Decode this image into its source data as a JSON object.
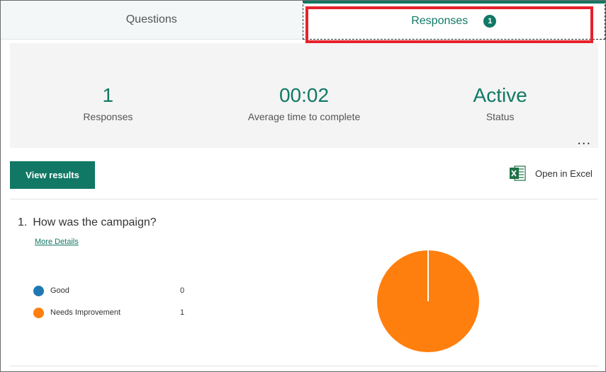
{
  "tabs": {
    "questions_label": "Questions",
    "responses_label": "Responses",
    "responses_count": "1"
  },
  "summary": {
    "responses_value": "1",
    "responses_label": "Responses",
    "avg_time_value": "00:02",
    "avg_time_label": "Average time to complete",
    "status_value": "Active",
    "status_label": "Status",
    "more_label": "..."
  },
  "toolbar": {
    "view_results_label": "View results",
    "open_excel_label": "Open in Excel"
  },
  "question": {
    "number": "1.",
    "text": "How was the campaign?",
    "more_details_label": "More Details"
  },
  "chart_data": {
    "type": "pie",
    "categories": [
      "Good",
      "Needs Improvement"
    ],
    "values": [
      0,
      1
    ],
    "colors": [
      "#1f78b4",
      "#ff7f0e"
    ]
  },
  "colors": {
    "accent": "#117865",
    "highlight": "#e5222c"
  }
}
